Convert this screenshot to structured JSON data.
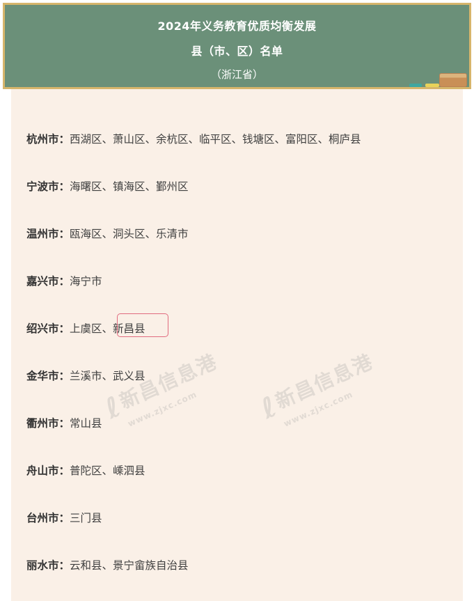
{
  "board": {
    "title_line1": "2024年义务教育优质均衡发展",
    "title_line2": "县（市、区）名单",
    "subtitle": "（浙江省）"
  },
  "rows": [
    {
      "city": "杭州市：",
      "counties": "西湖区、萧山区、余杭区、临平区、钱塘区、富阳区、桐庐县"
    },
    {
      "city": "宁波市：",
      "counties": "海曙区、镇海区、鄞州区"
    },
    {
      "city": "温州市：",
      "counties": "瓯海区、洞头区、乐清市"
    },
    {
      "city": "嘉兴市：",
      "counties": "海宁市"
    },
    {
      "city": "绍兴市：",
      "counties": "上虞区、新昌县"
    },
    {
      "city": "金华市：",
      "counties": "兰溪市、武义县"
    },
    {
      "city": "衢州市：",
      "counties": "常山县"
    },
    {
      "city": "舟山市：",
      "counties": "普陀区、嵊泗县"
    },
    {
      "city": "台州市：",
      "counties": "三门县"
    },
    {
      "city": "丽水市：",
      "counties": "云和县、景宁畲族自治县"
    }
  ],
  "watermark": {
    "name": "新昌信息港",
    "url": "www.zjxc.com"
  },
  "colors": {
    "board": "#6b9079",
    "board_frame": "#d6b56b",
    "card": "#faf0e7",
    "highlight": "#e06a7e"
  }
}
